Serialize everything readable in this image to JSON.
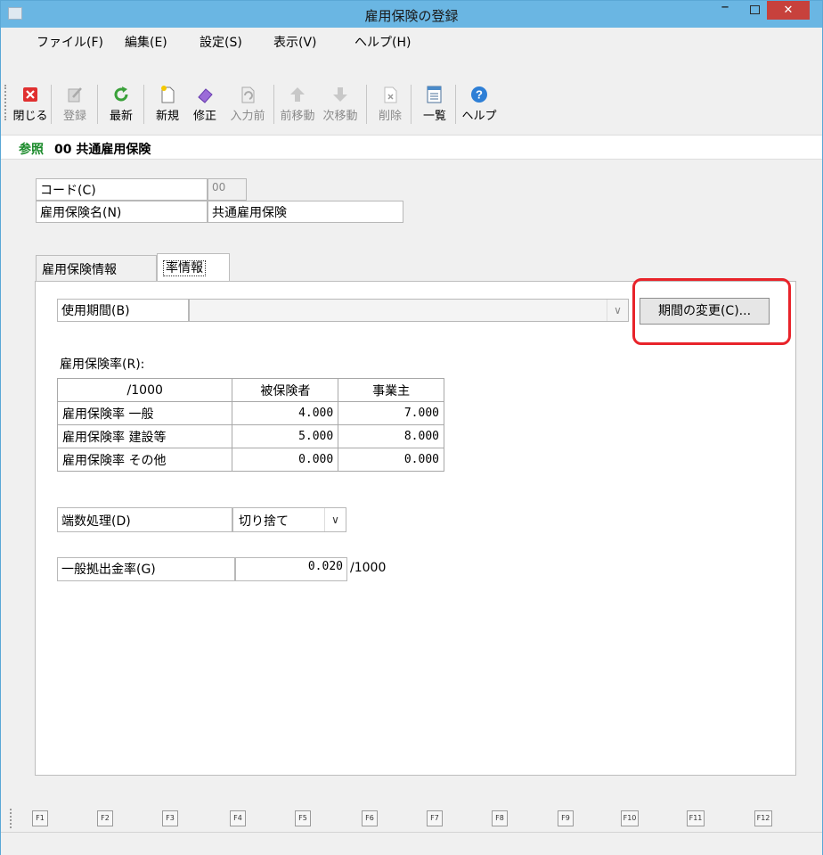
{
  "window": {
    "title": "雇用保険の登録",
    "close_glyph": "✕",
    "min_glyph": "–"
  },
  "menu": [
    "ファイル(F)",
    "編集(E)",
    "設定(S)",
    "表示(V)",
    "ヘルプ(H)"
  ],
  "toolbar": {
    "close": "閉じる",
    "register": "登録",
    "refresh": "最新",
    "new": "新規",
    "edit": "修正",
    "undo": "入力前",
    "prev": "前移動",
    "next": "次移動",
    "delete": "削除",
    "list": "一覧",
    "help": "ヘルプ"
  },
  "crumb": {
    "mode": "参照",
    "record": "00 共通雇用保険"
  },
  "form": {
    "code_label": "コード(C)",
    "code_value": "00",
    "name_label": "雇用保険名(N)",
    "name_value": "共通雇用保険"
  },
  "tabs": {
    "info": "雇用保険情報",
    "rate": "率情報"
  },
  "rate": {
    "period_label": "使用期間(B)",
    "period_value": "",
    "change_button": "期間の変更(C)...",
    "rates_caption": "雇用保険率(R):",
    "headers": [
      "/1000",
      "被保険者",
      "事業主"
    ],
    "rows": [
      {
        "name": "雇用保険率 一般",
        "insured": "4.000",
        "employer": "7.000"
      },
      {
        "name": "雇用保険率 建設等",
        "insured": "5.000",
        "employer": "8.000"
      },
      {
        "name": "雇用保険率 その他",
        "insured": "0.000",
        "employer": "0.000"
      }
    ],
    "rounding_label": "端数処理(D)",
    "rounding_value": "切り捨て",
    "contrib_label": "一般拠出金率(G)",
    "contrib_value": "0.020",
    "contrib_unit": "/1000"
  },
  "fkeys": [
    "F1",
    "F2",
    "F3",
    "F4",
    "F5",
    "F6",
    "F7",
    "F8",
    "F9",
    "F10",
    "F11",
    "F12"
  ],
  "colors": {
    "titlebar": "#6ab6e3",
    "mode_green": "#1a8a2a",
    "highlight_red": "#e8232a",
    "close_red": "#c7413c"
  }
}
